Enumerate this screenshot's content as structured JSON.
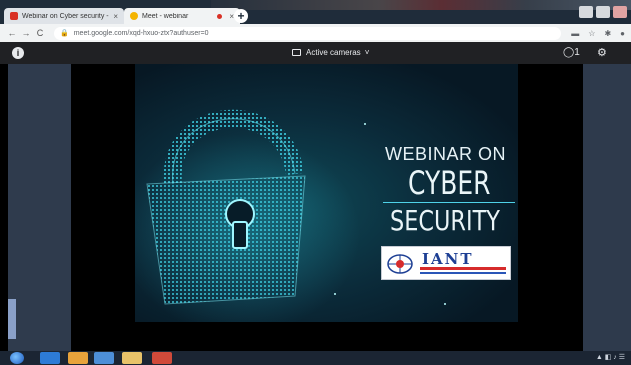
{
  "browser": {
    "tabs": [
      {
        "title": "Webinar on Cyber security - ... ",
        "close": "×"
      },
      {
        "title": "Meet - webinar",
        "close": "×"
      }
    ],
    "new_tab": "+",
    "url": "meet.google.com/xqd-hxuo-ztx?authuser=0",
    "nav": {
      "back": "←",
      "forward": "→",
      "reload": "C"
    }
  },
  "meet": {
    "info_icon": "i",
    "camera_label": "Active cameras",
    "camera_chevron": "˅",
    "chat_icon": "◯1",
    "settings_icon": "⚙"
  },
  "slide": {
    "line1": "WEBINAR ON",
    "line2": "CYBER",
    "line3": "SECURITY",
    "logo_text": "IANT"
  },
  "taskbar": {
    "tray_text": "▲ ◧ ♪  ☰"
  },
  "colors": {
    "accent": "#4fd2e8",
    "lock_glow": "#36c9e0",
    "logo_blue": "#1d3f94",
    "logo_red": "#d62b2b"
  }
}
